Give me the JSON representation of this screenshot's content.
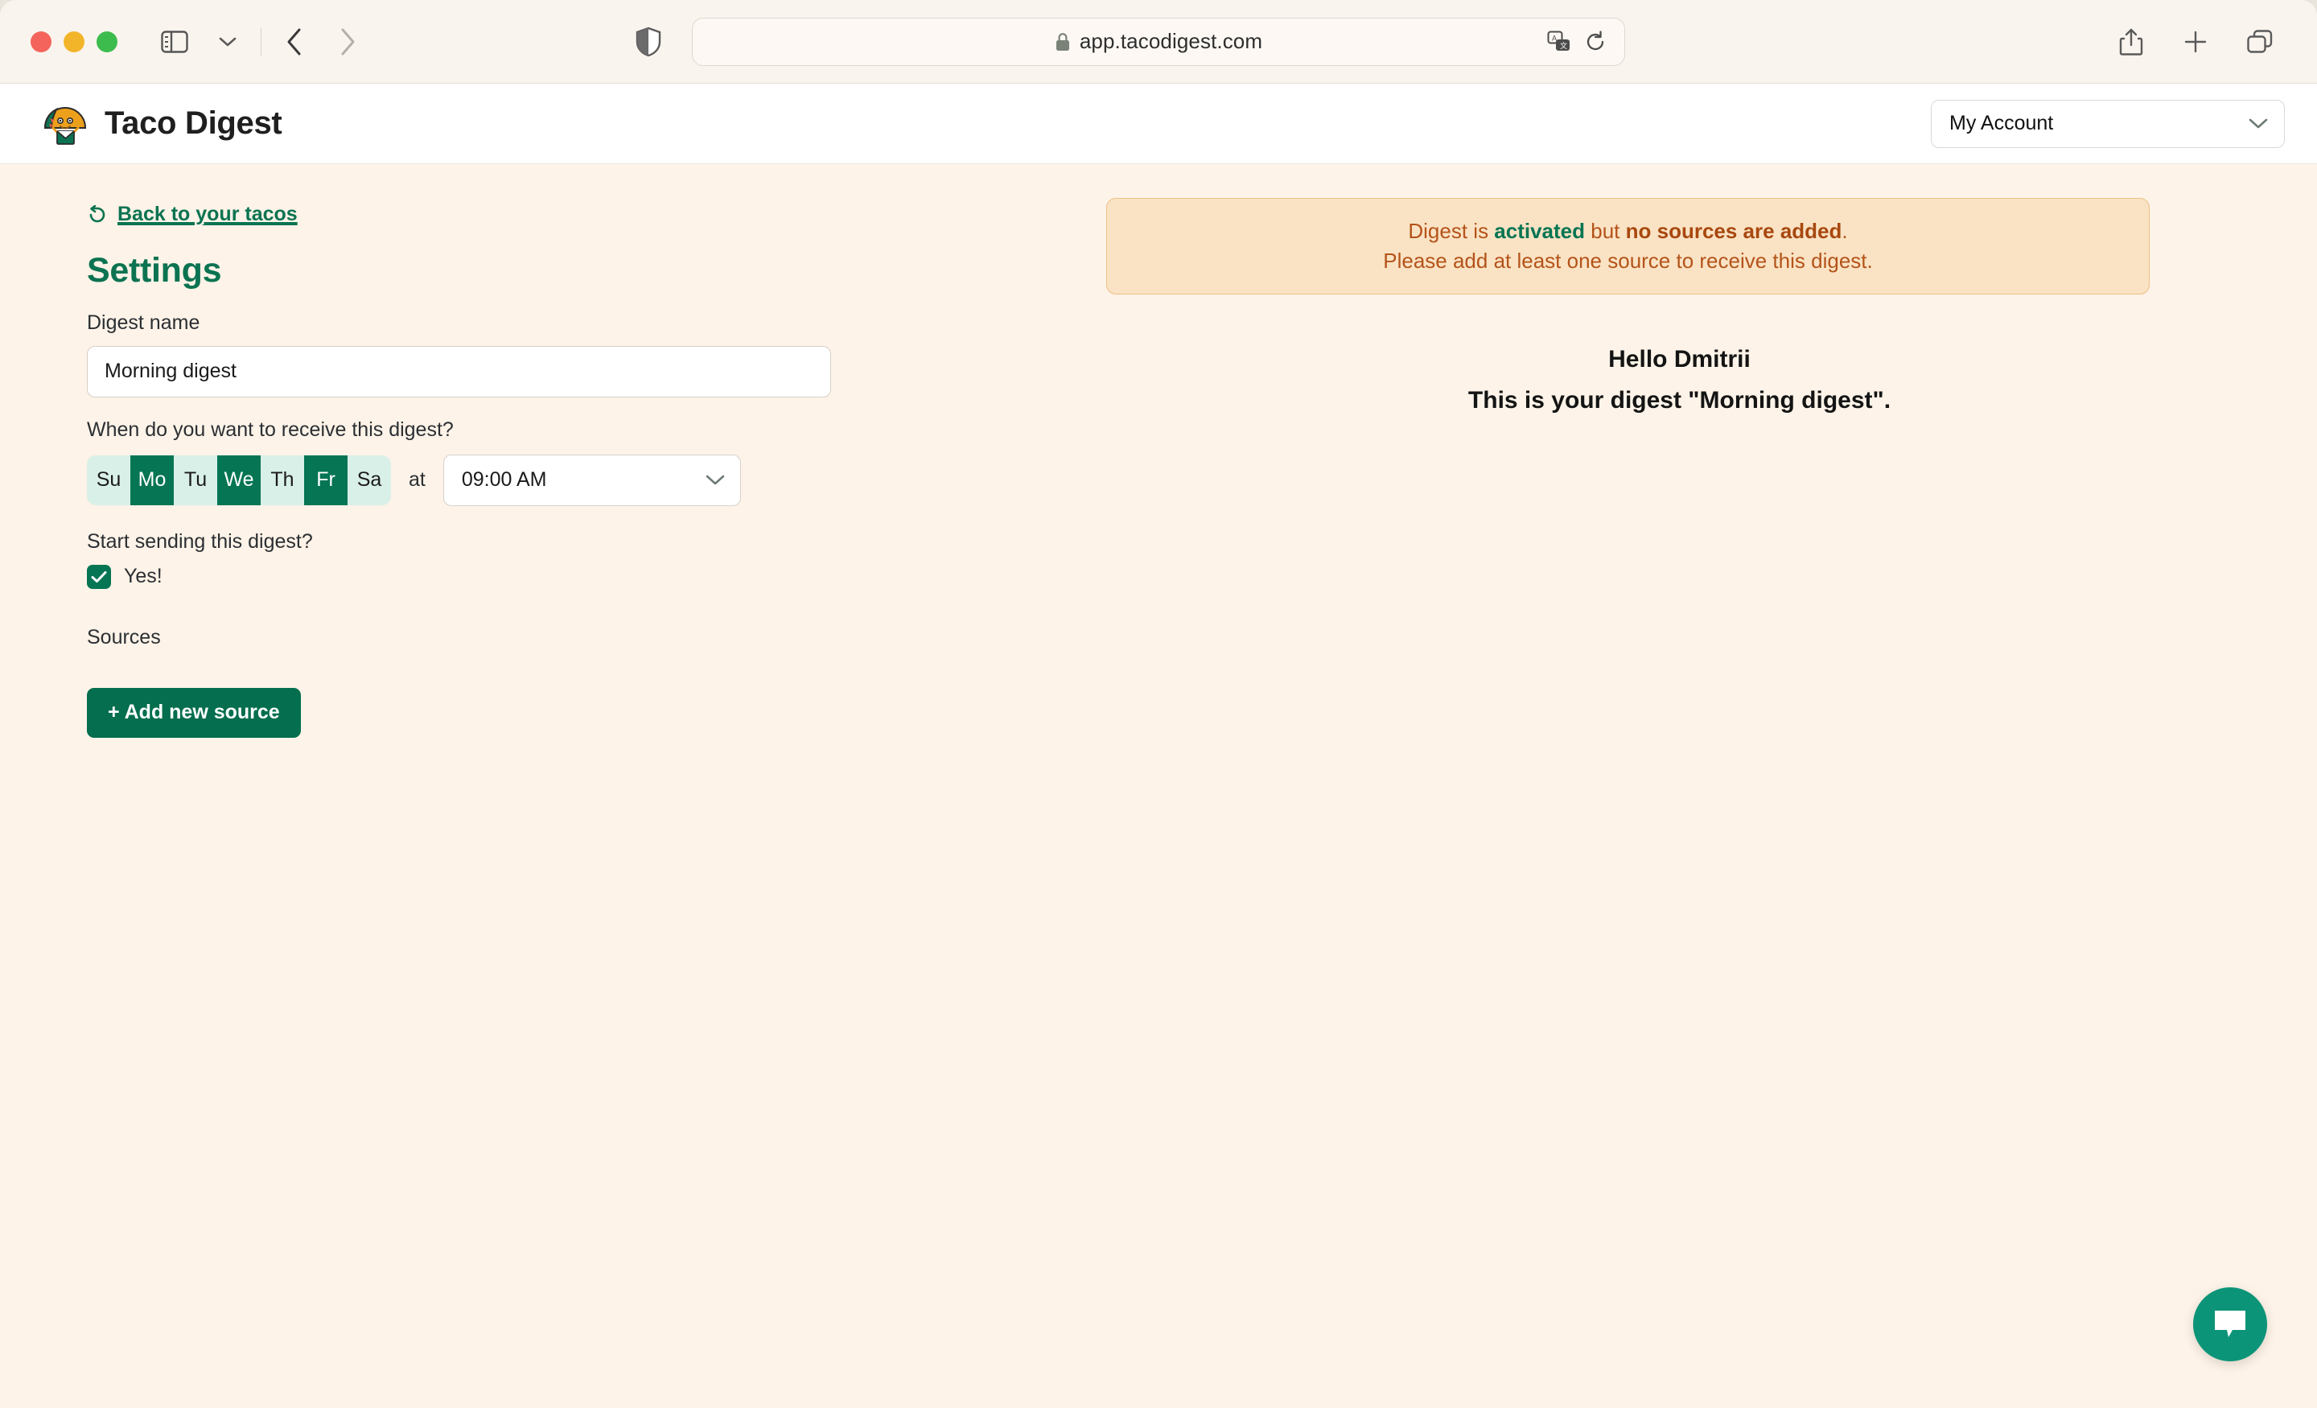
{
  "browser": {
    "url": "app.tacodigest.com",
    "icons": {
      "sidebar": "sidebar-toggle-icon",
      "sidebar_chevron": "chevron-down-icon",
      "back": "back-arrow-icon",
      "forward": "forward-arrow-icon",
      "shield": "privacy-shield-icon",
      "lock": "lock-icon",
      "translate": "translate-icon",
      "reload": "reload-icon",
      "share": "share-icon",
      "new_tab": "plus-icon",
      "tabs": "tab-overview-icon"
    }
  },
  "header": {
    "brand_name": "Taco Digest",
    "account_label": "My Account"
  },
  "sidebar": {
    "back_link": "Back to your tacos",
    "page_title": "Settings"
  },
  "form": {
    "digest_name_label": "Digest name",
    "digest_name_value": "Morning digest",
    "digest_name_placeholder": "Digest name",
    "when_label": "When do you want to receive this digest?",
    "days": [
      {
        "label": "Su",
        "selected": false
      },
      {
        "label": "Mo",
        "selected": true
      },
      {
        "label": "Tu",
        "selected": false
      },
      {
        "label": "We",
        "selected": true
      },
      {
        "label": "Th",
        "selected": false
      },
      {
        "label": "Fr",
        "selected": true
      },
      {
        "label": "Sa",
        "selected": false
      }
    ],
    "at_label": "at",
    "time_value": "09:00 AM",
    "start_label": "Start sending this digest?",
    "start_checkbox_label": "Yes!",
    "start_checked": true,
    "sources_label": "Sources",
    "add_source_label": "+ Add new source"
  },
  "alert": {
    "line1_part1": "Digest is ",
    "line1_activated": "activated",
    "line1_part2": " but ",
    "line1_nosources": "no sources are added",
    "line1_part3": ".",
    "line2": "Please add at least one source to receive this digest."
  },
  "preview": {
    "greeting": "Hello Dmitrii",
    "message": "This is your digest \"Morning digest\"."
  },
  "chat": {
    "icon": "chat-bubble-icon"
  },
  "colors": {
    "accent_green": "#0b7351",
    "selected_green": "#057553",
    "day_unselected": "#d9f0e8",
    "alert_bg": "#fae3c4",
    "alert_border": "#edbf85",
    "alert_text": "#b4531a",
    "page_bg": "#fdf3e8",
    "chat_green": "#0c9478"
  }
}
